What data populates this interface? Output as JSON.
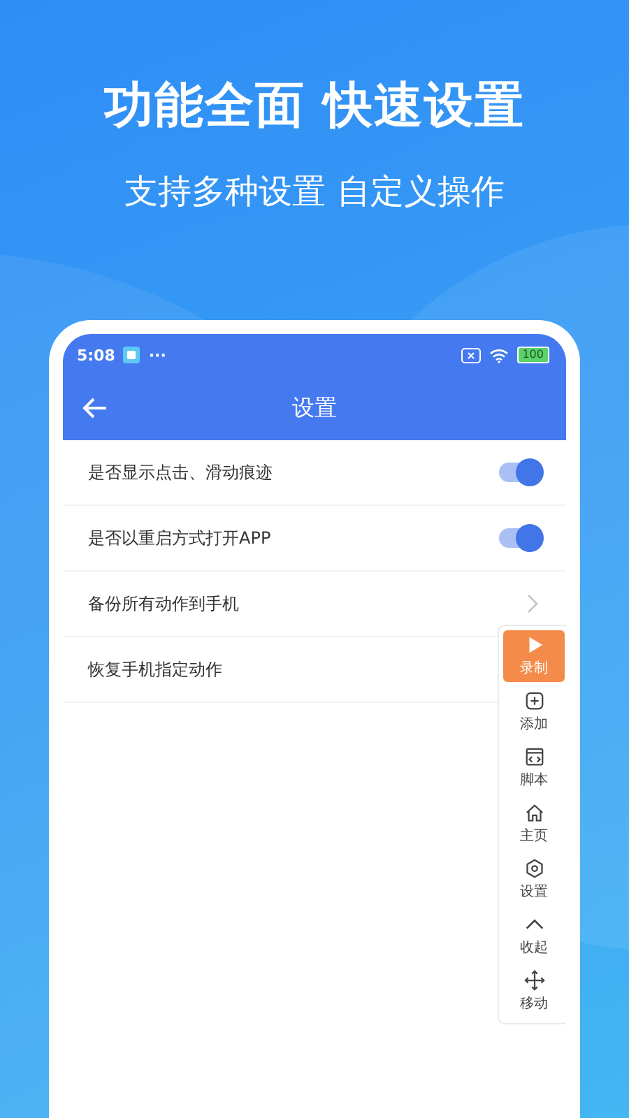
{
  "headline": "功能全面 快速设置",
  "subheadline": "支持多种设置 自定义操作",
  "status_bar": {
    "time": "5:08",
    "more": "···",
    "battery": "100"
  },
  "header": {
    "title": "设置"
  },
  "settings": [
    {
      "kind": "toggle",
      "label": "是否显示点击、滑动痕迹",
      "on": true
    },
    {
      "kind": "toggle",
      "label": "是否以重启方式打开APP",
      "on": true
    },
    {
      "kind": "link",
      "label": "备份所有动作到手机"
    },
    {
      "kind": "plain",
      "label": "恢复手机指定动作"
    }
  ],
  "toolbar": [
    {
      "kind": "play",
      "label": "录制",
      "selected": true
    },
    {
      "kind": "plus",
      "label": "添加",
      "selected": false
    },
    {
      "kind": "code",
      "label": "脚本",
      "selected": false
    },
    {
      "kind": "home",
      "label": "主页",
      "selected": false
    },
    {
      "kind": "gear",
      "label": "设置",
      "selected": false
    },
    {
      "kind": "collapse",
      "label": "收起",
      "selected": false
    },
    {
      "kind": "move",
      "label": "移动",
      "selected": false
    }
  ]
}
